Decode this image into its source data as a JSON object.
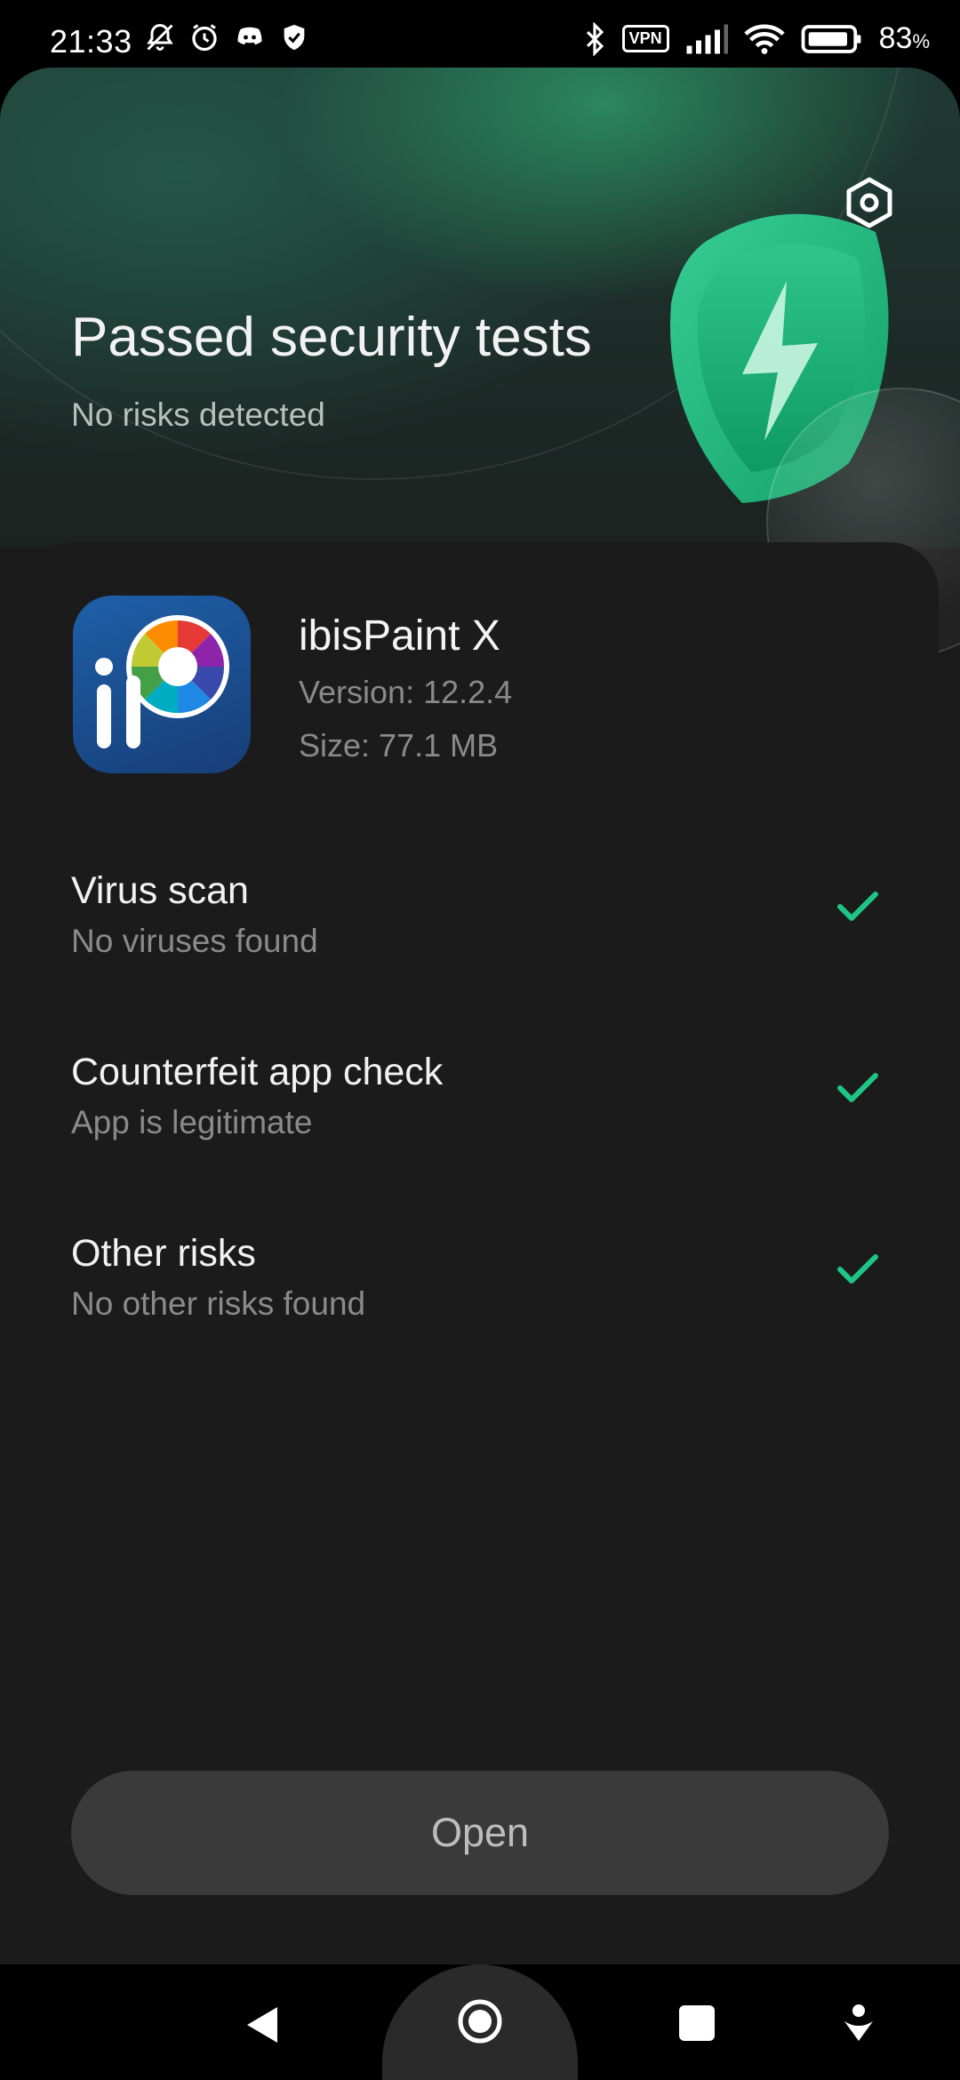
{
  "status_bar": {
    "time": "21:33",
    "battery_percent": "83",
    "battery_unit": "%",
    "vpn_label": "VPN",
    "icons_left": [
      "muted-bell-icon",
      "alarm-icon",
      "discord-icon",
      "shield-icon"
    ],
    "icons_right": [
      "bluetooth-icon",
      "vpn-icon",
      "signal-icon",
      "wifi-icon",
      "battery-icon"
    ]
  },
  "header": {
    "title": "Passed security tests",
    "subtitle": "No risks detected",
    "settings_icon": "settings-hexagon-icon"
  },
  "app": {
    "name": "ibisPaint X",
    "version": "Version: 12.2.4",
    "size": "Size: 77.1 MB",
    "icon": "ibispaint-app-icon"
  },
  "checks": [
    {
      "title": "Virus scan",
      "result": "No viruses found",
      "status": "passed"
    },
    {
      "title": "Counterfeit app check",
      "result": "App is legitimate",
      "status": "passed"
    },
    {
      "title": "Other risks",
      "result": "No other risks found",
      "status": "passed"
    }
  ],
  "actions": {
    "open_label": "Open"
  },
  "colors": {
    "accent_green": "#1ec584",
    "background": "#1b1b1b",
    "button_bg": "#3a3a3a"
  },
  "nav_bar": {
    "icons": [
      "back-icon",
      "home-icon",
      "recents-icon",
      "assistant-icon"
    ]
  }
}
